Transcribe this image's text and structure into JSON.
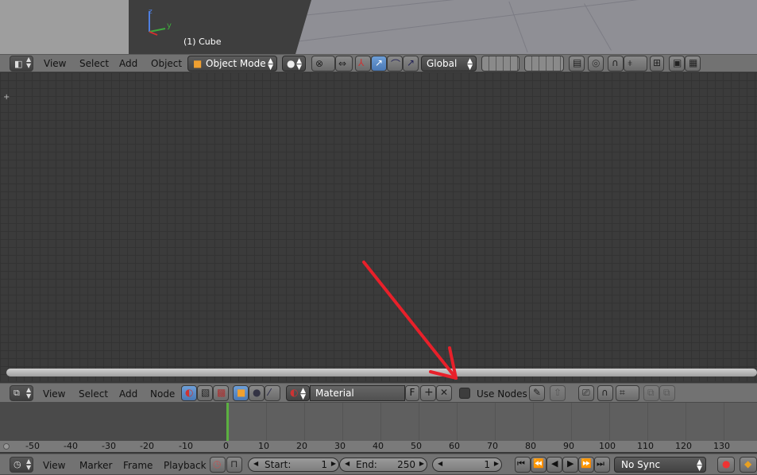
{
  "viewport": {
    "object_label": "(1) Cube",
    "axis_y": "y",
    "axis_z": "z"
  },
  "view3d_header": {
    "menus": [
      "View",
      "Select",
      "Add",
      "Object"
    ],
    "mode": "Object Mode",
    "orientation": "Global"
  },
  "node_header": {
    "menus": [
      "View",
      "Select",
      "Add",
      "Node"
    ],
    "material_name": "Material",
    "fake_user": "F",
    "use_nodes_label": "Use Nodes",
    "use_nodes_checked": false
  },
  "ruler": {
    "ticks": [
      "-50",
      "-40",
      "-30",
      "-20",
      "-10",
      "0",
      "10",
      "20",
      "30",
      "40",
      "50",
      "60",
      "70",
      "80",
      "90",
      "100",
      "110",
      "120",
      "130"
    ]
  },
  "timeline_header": {
    "menus": [
      "View",
      "Marker",
      "Frame",
      "Playback"
    ],
    "start_label": "Start:",
    "start_value": "1",
    "end_label": "End:",
    "end_value": "250",
    "current_frame": "1",
    "sync_mode": "No Sync"
  },
  "colors": {
    "annotation_arrow": "#e8202a",
    "playhead": "#5bb040",
    "selected": "#5a8fcf"
  }
}
